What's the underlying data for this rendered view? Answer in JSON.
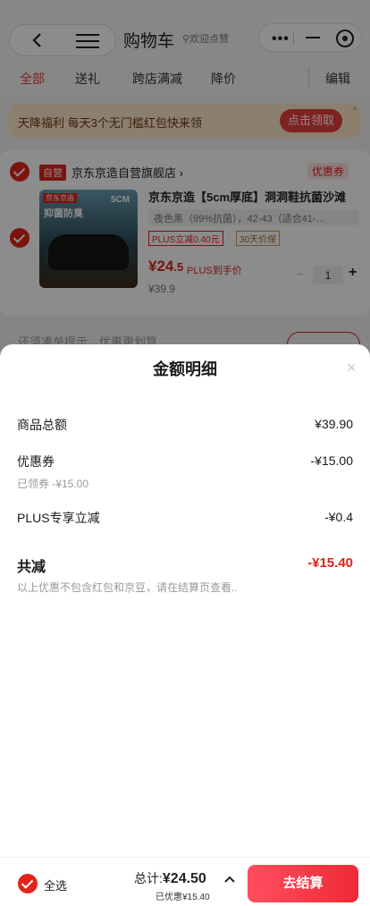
{
  "header": {
    "title": "购物车",
    "welcome": "欢迎点赞",
    "capsule_dots": "•••"
  },
  "filters": [
    {
      "label": "全部",
      "active": true
    },
    {
      "label": "送礼",
      "active": false
    },
    {
      "label": "跨店满减",
      "active": false
    },
    {
      "label": "降价",
      "active": false
    },
    {
      "label": "编辑",
      "active": false
    }
  ],
  "banner": {
    "text": "天降福利 每天3个无门槛红包快来领",
    "button": "点击领取",
    "close": "×"
  },
  "shop": {
    "tag": "自营",
    "name": "京东京造自营旗舰店 ›",
    "coupon": "优惠券"
  },
  "product": {
    "image_brand": "京东京造",
    "image_slogan": "抑菌防臭",
    "image_size": "5CM",
    "title": "京东京造【5cm厚底】洞洞鞋抗菌沙滩",
    "spec": "夜色黑（99%抗菌），42-43（适合41-…",
    "badge_plus": "PLUS立减0.40元",
    "badge_30": "30天价保",
    "price_symbol": "¥",
    "price_int": "24",
    "price_dec": ".5",
    "plus_price": "PLUS到手价",
    "original_price": "¥39.9",
    "quantity": "1",
    "dec": "−",
    "inc": "+"
  },
  "hint": {
    "text": "还须凑单提示，优惠更划算"
  },
  "sheet": {
    "title": "金额明细",
    "close": "×",
    "rows": [
      {
        "label": "商品总额",
        "value": "¥39.90",
        "sub": ""
      },
      {
        "label": "优惠券",
        "value": "-¥15.00",
        "sub": "已领券 -¥15.00"
      },
      {
        "label": "PLUS专享立减",
        "value": "-¥0.4",
        "sub": ""
      }
    ],
    "total_label": "共减",
    "total_value": "-¥15.40",
    "note": "以上优惠不包含红包和京豆，请在结算页查看.."
  },
  "bottom_bar": {
    "select_all": "全选",
    "total_prefix": "总计:",
    "total_amount": "¥24.50",
    "saved": "已优惠¥15.40",
    "checkout": "去结算"
  }
}
